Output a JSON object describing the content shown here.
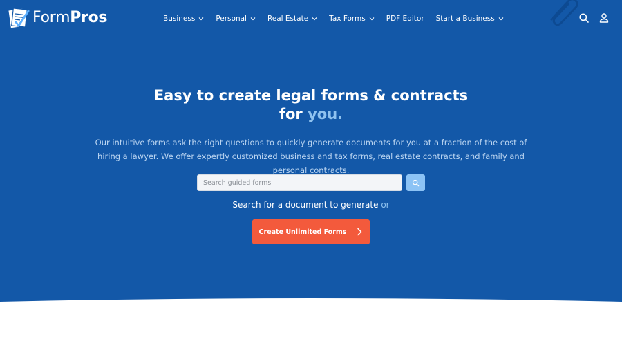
{
  "brand": {
    "name_light": "Form",
    "name_bold": "Pros"
  },
  "nav": {
    "items": [
      {
        "label": "Business",
        "has_dropdown": true
      },
      {
        "label": "Personal",
        "has_dropdown": true
      },
      {
        "label": "Real Estate",
        "has_dropdown": true
      },
      {
        "label": "Tax Forms",
        "has_dropdown": true
      },
      {
        "label": "PDF Editor",
        "has_dropdown": false
      },
      {
        "label": "Start a Business",
        "has_dropdown": true
      }
    ]
  },
  "header_icons": [
    "search-icon",
    "user-icon"
  ],
  "hero": {
    "headline_line1": "Easy to create legal forms & contracts",
    "headline_line2_prefix": "for ",
    "headline_line2_accent": "you.",
    "description": "Our intuitive forms ask the right questions to quickly generate documents for you at a fraction of the cost of hiring a lawyer. We offer expertly customized business and tax forms, real estate contracts, and family and personal contracts.",
    "search_placeholder": "Search guided forms",
    "search_caption": "Search for a document to generate",
    "search_caption_or": " or",
    "cta_label": "Create Unlimited Forms"
  },
  "colors": {
    "hero_bg": "#1358a8",
    "accent_text": "#8fc2ef",
    "cta_bg": "#f35a3c",
    "search_button_bg": "#8cc3f5"
  }
}
